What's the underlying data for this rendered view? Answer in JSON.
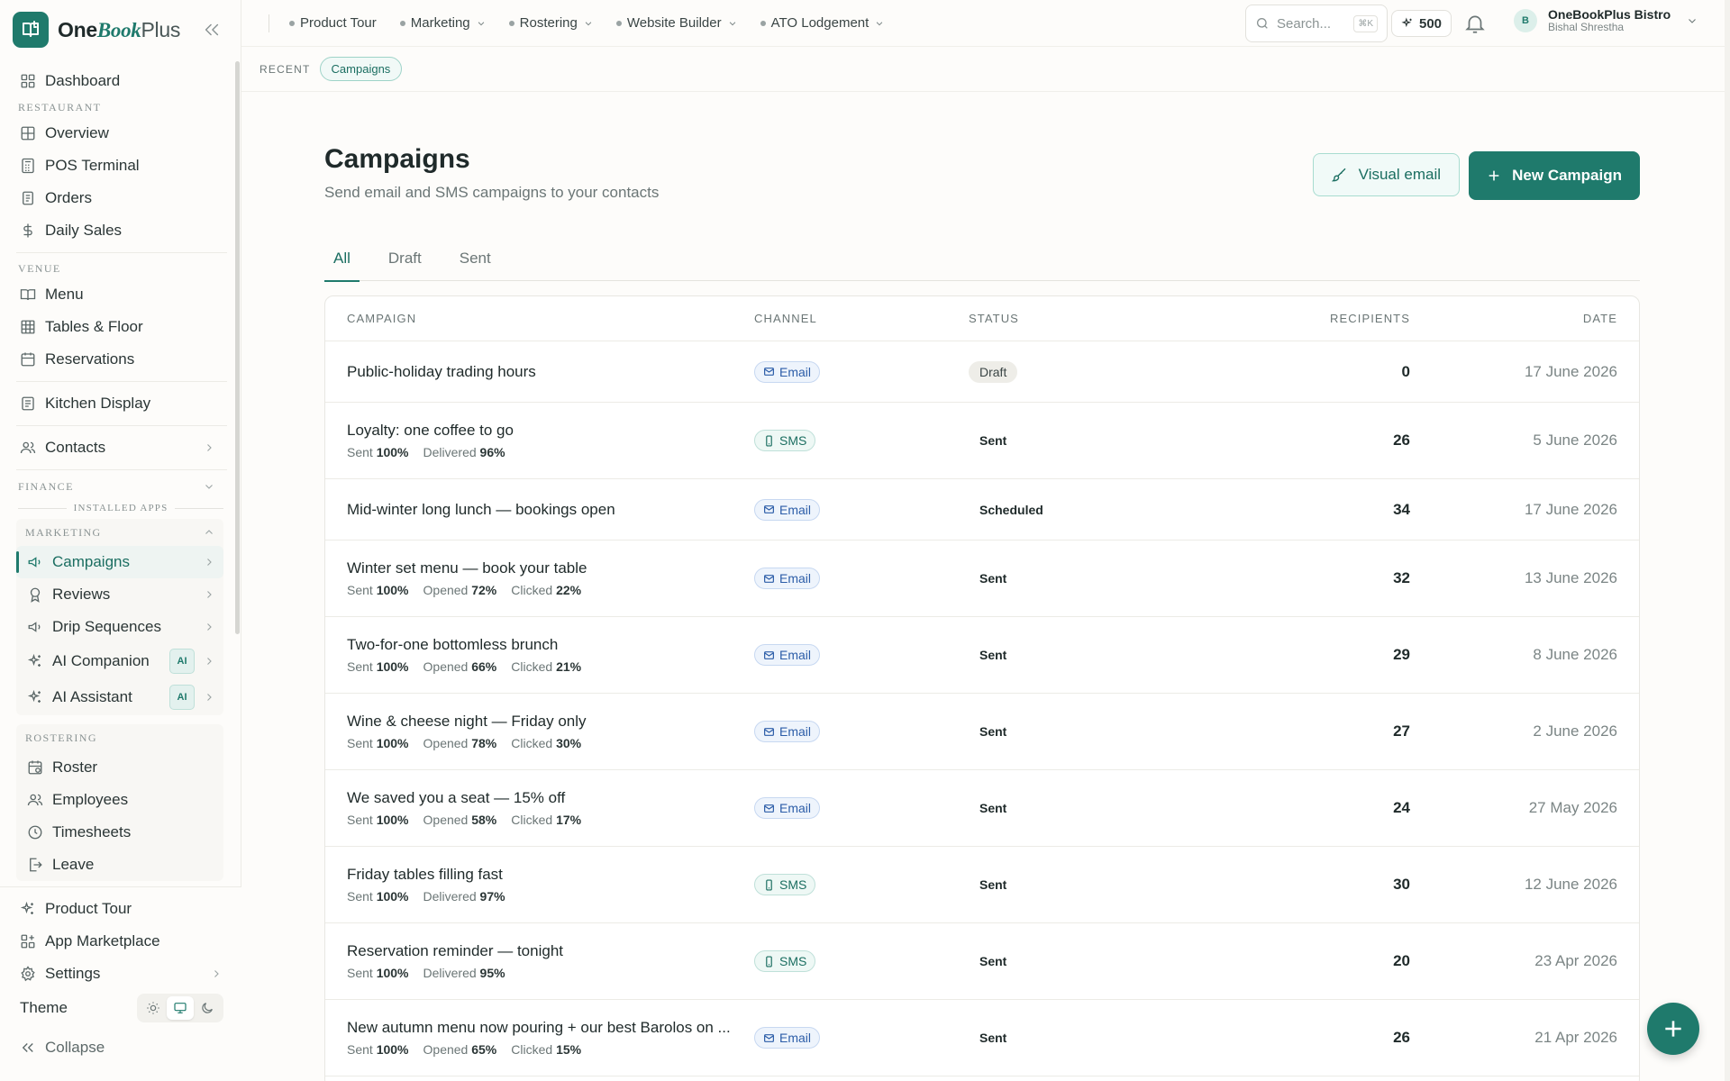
{
  "brand": {
    "part1": "One",
    "part2": "Book",
    "part3": "Plus"
  },
  "sidebar": {
    "top_items": [
      {
        "label": "Dashboard"
      }
    ],
    "restaurant_label": "RESTAURANT",
    "restaurant_items": [
      {
        "label": "Overview"
      },
      {
        "label": "POS Terminal"
      },
      {
        "label": "Orders"
      },
      {
        "label": "Daily Sales"
      }
    ],
    "venue_label": "VENUE",
    "venue_items": [
      {
        "label": "Menu"
      },
      {
        "label": "Tables & Floor"
      },
      {
        "label": "Reservations"
      }
    ],
    "kitchen": "Kitchen Display",
    "contacts": "Contacts",
    "finance_label": "FINANCE",
    "installed_label": "INSTALLED APPS",
    "marketing_label": "MARKETING",
    "marketing_items": [
      {
        "label": "Campaigns"
      },
      {
        "label": "Reviews"
      },
      {
        "label": "Drip Sequences"
      },
      {
        "label": "AI Companion",
        "badge": "AI"
      },
      {
        "label": "AI Assistant",
        "badge": "AI"
      }
    ],
    "rostering_label": "ROSTERING",
    "rostering_items": [
      {
        "label": "Roster"
      },
      {
        "label": "Employees"
      },
      {
        "label": "Timesheets"
      },
      {
        "label": "Leave"
      }
    ],
    "bottom_items": [
      {
        "label": "Product Tour"
      },
      {
        "label": "App Marketplace"
      },
      {
        "label": "Settings"
      }
    ],
    "theme_label": "Theme",
    "collapse_label": "Collapse"
  },
  "topbar": {
    "links": [
      {
        "label": "Product Tour"
      },
      {
        "label": "Marketing"
      },
      {
        "label": "Rostering"
      },
      {
        "label": "Website Builder"
      },
      {
        "label": "ATO Lodgement"
      }
    ],
    "search_placeholder": "Search...",
    "search_kbd": "⌘K",
    "credits": "500",
    "account_initial": "B",
    "account_name": "OneBookPlus Bistro",
    "account_user": "Bishal Shrestha"
  },
  "recent": {
    "label": "RECENT",
    "chip": "Campaigns"
  },
  "page": {
    "title": "Campaigns",
    "subtitle": "Send email and SMS campaigns to your contacts",
    "visual_email": "Visual email",
    "new_campaign": "New Campaign",
    "tabs": [
      {
        "label": "All"
      },
      {
        "label": "Draft"
      },
      {
        "label": "Sent"
      }
    ]
  },
  "table": {
    "headers": {
      "campaign": "CAMPAIGN",
      "channel": "CHANNEL",
      "status": "STATUS",
      "recipients": "RECIPIENTS",
      "date": "DATE"
    },
    "rows": [
      {
        "name": "Public-holiday trading hours",
        "channel": "Email",
        "status": "Draft",
        "recipients": "0",
        "date": "17 June 2026"
      },
      {
        "name": "Loyalty: one coffee to go",
        "m1l": "Sent",
        "m1v": "100%",
        "m2l": "Delivered",
        "m2v": "96%",
        "channel": "SMS",
        "status": "Sent",
        "recipients": "26",
        "date": "5 June 2026"
      },
      {
        "name": "Mid-winter long lunch — bookings open",
        "channel": "Email",
        "status": "Scheduled",
        "recipients": "34",
        "date": "17 June 2026"
      },
      {
        "name": "Winter set menu — book your table",
        "m1l": "Sent",
        "m1v": "100%",
        "m2l": "Opened",
        "m2v": "72%",
        "m3l": "Clicked",
        "m3v": "22%",
        "channel": "Email",
        "status": "Sent",
        "recipients": "32",
        "date": "13 June 2026"
      },
      {
        "name": "Two-for-one bottomless brunch",
        "m1l": "Sent",
        "m1v": "100%",
        "m2l": "Opened",
        "m2v": "66%",
        "m3l": "Clicked",
        "m3v": "21%",
        "channel": "Email",
        "status": "Sent",
        "recipients": "29",
        "date": "8 June 2026"
      },
      {
        "name": "Wine & cheese night — Friday only",
        "m1l": "Sent",
        "m1v": "100%",
        "m2l": "Opened",
        "m2v": "78%",
        "m3l": "Clicked",
        "m3v": "30%",
        "channel": "Email",
        "status": "Sent",
        "recipients": "27",
        "date": "2 June 2026"
      },
      {
        "name": "We saved you a seat — 15% off",
        "m1l": "Sent",
        "m1v": "100%",
        "m2l": "Opened",
        "m2v": "58%",
        "m3l": "Clicked",
        "m3v": "17%",
        "channel": "Email",
        "status": "Sent",
        "recipients": "24",
        "date": "27 May 2026"
      },
      {
        "name": "Friday tables filling fast",
        "m1l": "Sent",
        "m1v": "100%",
        "m2l": "Delivered",
        "m2v": "97%",
        "channel": "SMS",
        "status": "Sent",
        "recipients": "30",
        "date": "12 June 2026"
      },
      {
        "name": "Reservation reminder — tonight",
        "m1l": "Sent",
        "m1v": "100%",
        "m2l": "Delivered",
        "m2v": "95%",
        "channel": "SMS",
        "status": "Sent",
        "recipients": "20",
        "date": "23 Apr 2026"
      },
      {
        "name": "New autumn menu now pouring + our best Barolos on ...",
        "m1l": "Sent",
        "m1v": "100%",
        "m2l": "Opened",
        "m2v": "65%",
        "m3l": "Clicked",
        "m3v": "15%",
        "channel": "Email",
        "status": "Sent",
        "recipients": "26",
        "date": "21 Apr 2026"
      }
    ]
  },
  "colors": {
    "accent": "#1f7a6c",
    "email": "#2c5da8",
    "background": "#fdfcfa"
  }
}
